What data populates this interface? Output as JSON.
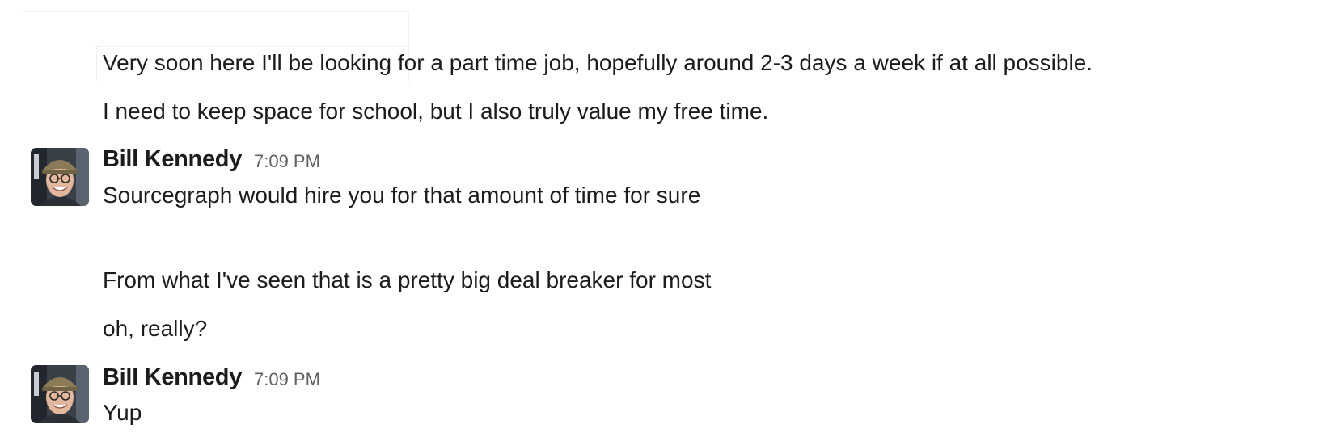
{
  "messages": [
    {
      "type": "continuation",
      "text": "Very soon here I'll be looking for a part time job, hopefully around 2-3 days a week if at all possible."
    },
    {
      "type": "continuation",
      "text": "I need to keep space for school, but I also truly value my free time."
    },
    {
      "type": "group",
      "author": "Bill Kennedy",
      "time": "7:09 PM",
      "avatar_icon": "user-avatar-photo",
      "lines": [
        "Sourcegraph would hire you for that amount of time for sure",
        "From what I've seen that is a pretty big deal breaker for most"
      ]
    },
    {
      "type": "continuation",
      "text": "oh, really?"
    },
    {
      "type": "group",
      "author": "Bill Kennedy",
      "time": "7:09 PM",
      "avatar_icon": "user-avatar-photo",
      "lines": [
        "Yup"
      ]
    }
  ],
  "colors": {
    "text": "#1d1c1d",
    "timestamp": "#616061",
    "background": "#ffffff"
  }
}
